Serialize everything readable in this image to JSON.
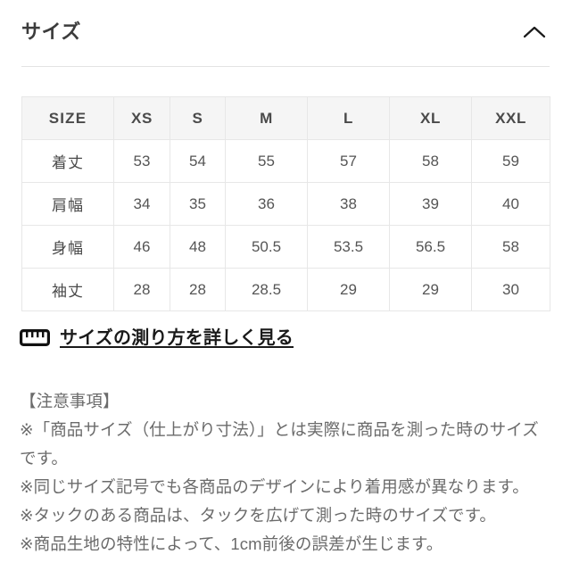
{
  "section": {
    "title": "サイズ",
    "collapse_icon": "chevron-up-icon",
    "expanded": true
  },
  "size_table": {
    "columns": [
      "SIZE",
      "XS",
      "S",
      "M",
      "L",
      "XL",
      "XXL"
    ],
    "rows": [
      {
        "label": "着丈",
        "values": [
          "53",
          "54",
          "55",
          "57",
          "58",
          "59"
        ]
      },
      {
        "label": "肩幅",
        "values": [
          "34",
          "35",
          "36",
          "38",
          "39",
          "40"
        ]
      },
      {
        "label": "身幅",
        "values": [
          "46",
          "48",
          "50.5",
          "53.5",
          "56.5",
          "58"
        ]
      },
      {
        "label": "袖丈",
        "values": [
          "28",
          "28",
          "28.5",
          "29",
          "29",
          "30"
        ]
      }
    ]
  },
  "measure_link": {
    "icon": "ruler-icon",
    "label": "サイズの測り方を詳しく見る"
  },
  "notes": {
    "heading": "【注意事項】",
    "lines": [
      "※「商品サイズ（仕上がり寸法）」とは実際に商品を測った時のサイズです。",
      "※同じサイズ記号でも各商品のデザインにより着用感が異なります。",
      "※タックのある商品は、タックを広げて測った時のサイズです。",
      "※商品生地の特性によって、1cm前後の誤差が生じます。"
    ]
  },
  "colors": {
    "background": "#ffffff",
    "title_text": "#3c3c3c",
    "table_header_bg": "#f5f5f5",
    "table_border": "#e7e7e7",
    "body_text": "#555555",
    "note_text": "#6b6b6b",
    "link_text": "#1a1a1a",
    "divider": "#e3e3e3"
  }
}
